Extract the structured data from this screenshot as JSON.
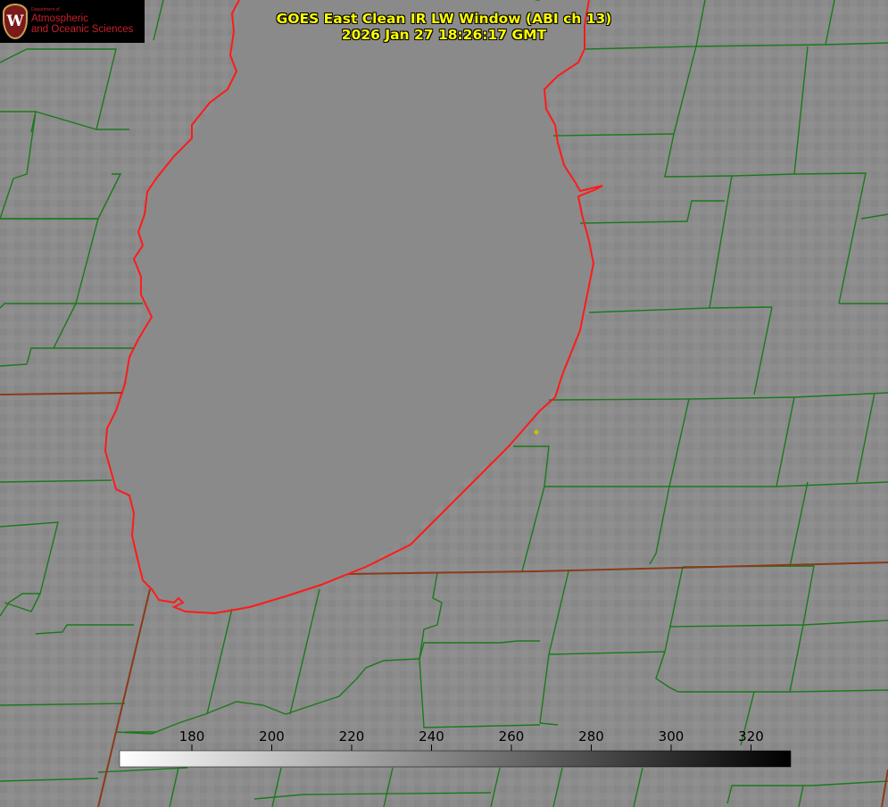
{
  "header": {
    "title_line1": "GOES East Clean IR LW Window (ABI ch 13)",
    "title_line2": "2026 Jan 27 18:26:17 GMT",
    "title_color": "#ffff00"
  },
  "logo": {
    "crest_letter": "W",
    "dept": "Department of",
    "line1": "Atmospheric",
    "line2": "and Oceanic Sciences",
    "text_color": "#c8202a"
  },
  "colorbar": {
    "ticks": [
      "180",
      "200",
      "220",
      "240",
      "260",
      "280",
      "300",
      "320"
    ],
    "gradient_from": "#ffffff",
    "gradient_to": "#000000"
  },
  "map": {
    "background_color": "#8a8a8a",
    "county_line_color": "#1a7a1a",
    "state_line_color": "#8b3a1a",
    "lake_shore_color": "#ff1a1a",
    "marker_color": "#c8c000"
  }
}
